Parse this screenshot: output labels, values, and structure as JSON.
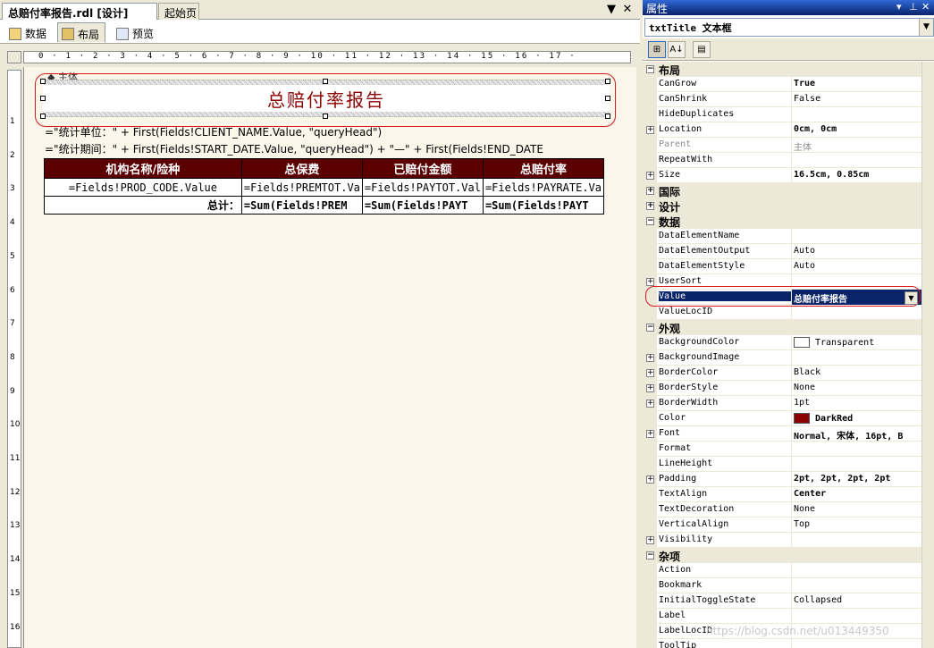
{
  "doc_tabs": {
    "active": "总赔付率报告.rdl [设计]",
    "inactive": "起始页",
    "dropdown_glyph": "▼",
    "close_glyph": "✕"
  },
  "view_tabs": [
    "数据",
    "布局",
    "预览"
  ],
  "ruler_h_text": "0 · 1 · 2 · 3 · 4 · 5 · 6 · 7 · 8 · 9 · 10 · 11 · 12 · 13 · 14 · 15 · 16 · 17 ·",
  "ruler_v_numbers": [
    "1",
    "2",
    "3",
    "4",
    "5",
    "6",
    "7",
    "8",
    "9",
    "10",
    "11",
    "12",
    "13",
    "14",
    "15",
    "16"
  ],
  "report": {
    "body_label": "主体",
    "title": "总赔付率报告",
    "expr_line1": "=\"统计单位：\" + First(Fields!CLIENT_NAME.Value, \"queryHead\")",
    "expr_line2": "=\"统计期间：\" + First(Fields!START_DATE.Value, \"queryHead\") + \"—\" + First(Fields!END_DATE",
    "table": {
      "headers": [
        "机构名称/险种",
        "总保费",
        "已赔付金额",
        "总赔付率"
      ],
      "detail": [
        "=Fields!PROD_CODE.Value",
        "=Fields!PREMTOT.Va",
        "=Fields!PAYTOT.Val",
        "=Fields!PAYRATE.Va"
      ],
      "total": [
        "总计：",
        "=Sum(Fields!PREM",
        "=Sum(Fields!PAYT",
        "=Sum(Fields!PAYT"
      ]
    },
    "title_color": "#8b0000"
  },
  "properties_panel": {
    "title": "属性",
    "title_buttons": [
      "▾",
      "⊥",
      "✕"
    ],
    "object": "txtTitle 文本框",
    "toolbar": [
      "⊞",
      "A↓",
      "▤"
    ],
    "rows": [
      {
        "cat": true,
        "expander": "⊟",
        "name": "布局"
      },
      {
        "name": "CanGrow",
        "value": "True",
        "bold": true
      },
      {
        "name": "CanShrink",
        "value": "False"
      },
      {
        "name": "HideDuplicates",
        "value": ""
      },
      {
        "expander": "⊞",
        "name": "Location",
        "value": "0cm, 0cm",
        "bold": true
      },
      {
        "name": "Parent",
        "value": "主体",
        "gray": true
      },
      {
        "name": "RepeatWith",
        "value": ""
      },
      {
        "expander": "⊞",
        "name": "Size",
        "value": "16.5cm, 0.85cm",
        "bold": true
      },
      {
        "cat": true,
        "expander": "⊞",
        "name": "国际"
      },
      {
        "cat": true,
        "expander": "⊞",
        "name": "设计"
      },
      {
        "cat": true,
        "expander": "⊟",
        "name": "数据"
      },
      {
        "name": "DataElementName",
        "value": ""
      },
      {
        "name": "DataElementOutput",
        "value": "Auto"
      },
      {
        "name": "DataElementStyle",
        "value": "Auto"
      },
      {
        "expander": "⊞",
        "name": "UserSort",
        "value": ""
      },
      {
        "name": "Value",
        "value": "总赔付率报告",
        "selected": true
      },
      {
        "name": "ValueLocID",
        "value": ""
      },
      {
        "cat": true,
        "expander": "⊟",
        "name": "外观"
      },
      {
        "name": "BackgroundColor",
        "value": "Transparent",
        "swatch": "#ffffff"
      },
      {
        "expander": "⊞",
        "name": "BackgroundImage",
        "value": ""
      },
      {
        "expander": "⊞",
        "name": "BorderColor",
        "value": "Black"
      },
      {
        "expander": "⊞",
        "name": "BorderStyle",
        "value": "None"
      },
      {
        "expander": "⊞",
        "name": "BorderWidth",
        "value": "1pt"
      },
      {
        "name": "Color",
        "value": "DarkRed",
        "swatch": "#8b0000",
        "bold": true
      },
      {
        "expander": "⊞",
        "name": "Font",
        "value": "Normal, 宋体, 16pt, B",
        "bold": true
      },
      {
        "name": "Format",
        "value": ""
      },
      {
        "name": "LineHeight",
        "value": ""
      },
      {
        "expander": "⊞",
        "name": "Padding",
        "value": "2pt, 2pt, 2pt, 2pt",
        "bold": true
      },
      {
        "name": "TextAlign",
        "value": "Center",
        "bold": true
      },
      {
        "name": "TextDecoration",
        "value": "None"
      },
      {
        "name": "VerticalAlign",
        "value": "Top"
      },
      {
        "expander": "⊞",
        "name": "Visibility",
        "value": ""
      },
      {
        "cat": true,
        "expander": "⊟",
        "name": "杂项"
      },
      {
        "name": "Action",
        "value": ""
      },
      {
        "name": "Bookmark",
        "value": ""
      },
      {
        "name": "InitialToggleState",
        "value": "Collapsed"
      },
      {
        "name": "Label",
        "value": ""
      },
      {
        "name": "LabelLocID",
        "value": ""
      },
      {
        "name": "ToolTip",
        "value": ""
      }
    ]
  },
  "watermark": "https://blog.csdn.net/u013449350"
}
